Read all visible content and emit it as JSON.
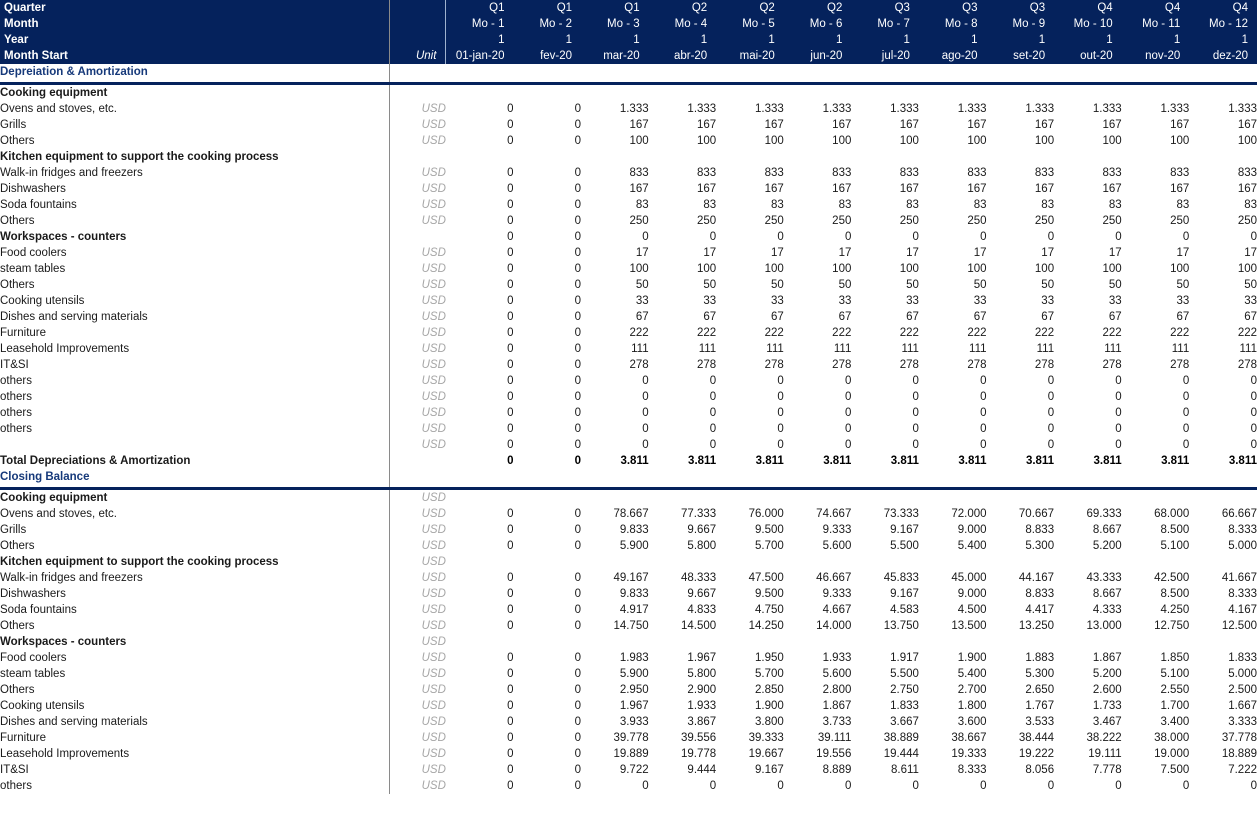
{
  "header": {
    "row_labels": [
      "Quarter",
      "Month",
      "Year",
      "Month Start"
    ],
    "unit_label": "Unit",
    "quarters": [
      "Q1",
      "Q1",
      "Q1",
      "Q2",
      "Q2",
      "Q2",
      "Q3",
      "Q3",
      "Q3",
      "Q4",
      "Q4",
      "Q4"
    ],
    "months": [
      "Mo -  1",
      "Mo -  2",
      "Mo -  3",
      "Mo -  4",
      "Mo -  5",
      "Mo -  6",
      "Mo -  7",
      "Mo -  8",
      "Mo -  9",
      "Mo -  10",
      "Mo -  11",
      "Mo -  12"
    ],
    "years": [
      "1",
      "1",
      "1",
      "1",
      "1",
      "1",
      "1",
      "1",
      "1",
      "1",
      "1",
      "1"
    ],
    "month_start": [
      "01-jan-20",
      "fev-20",
      "mar-20",
      "abr-20",
      "mai-20",
      "jun-20",
      "jul-20",
      "ago-20",
      "set-20",
      "out-20",
      "nov-20",
      "dez-20"
    ]
  },
  "colors": {
    "header_bg": "#05225c",
    "header_text": "#ffffff",
    "section_text": "#16397a",
    "unit_text": "#a6a6a6",
    "body_text": "#1a1a1a"
  },
  "sections": [
    {
      "title": "Depreiation & Amortization",
      "rows": [
        {
          "label": "Cooking equipment",
          "indent": 1,
          "bold": true,
          "unit": "",
          "values": []
        },
        {
          "label": "Ovens and stoves, etc.",
          "indent": 3,
          "bold": false,
          "unit": "USD",
          "values": [
            "0",
            "0",
            "1.333",
            "1.333",
            "1.333",
            "1.333",
            "1.333",
            "1.333",
            "1.333",
            "1.333",
            "1.333",
            "1.333"
          ]
        },
        {
          "label": "Grills",
          "indent": 3,
          "bold": false,
          "unit": "USD",
          "values": [
            "0",
            "0",
            "167",
            "167",
            "167",
            "167",
            "167",
            "167",
            "167",
            "167",
            "167",
            "167"
          ]
        },
        {
          "label": "Others",
          "indent": 2,
          "bold": false,
          "unit": "USD",
          "values": [
            "0",
            "0",
            "100",
            "100",
            "100",
            "100",
            "100",
            "100",
            "100",
            "100",
            "100",
            "100"
          ]
        },
        {
          "label": "Kitchen equipment to support the cooking process",
          "indent": 1,
          "bold": true,
          "unit": "",
          "values": []
        },
        {
          "label": "Walk-in fridges and freezers",
          "indent": 3,
          "bold": false,
          "unit": "USD",
          "values": [
            "0",
            "0",
            "833",
            "833",
            "833",
            "833",
            "833",
            "833",
            "833",
            "833",
            "833",
            "833"
          ]
        },
        {
          "label": "Dishwashers",
          "indent": 3,
          "bold": false,
          "unit": "USD",
          "values": [
            "0",
            "0",
            "167",
            "167",
            "167",
            "167",
            "167",
            "167",
            "167",
            "167",
            "167",
            "167"
          ]
        },
        {
          "label": "Soda fountains",
          "indent": 2,
          "bold": false,
          "unit": "USD",
          "values": [
            "0",
            "0",
            "83",
            "83",
            "83",
            "83",
            "83",
            "83",
            "83",
            "83",
            "83",
            "83"
          ]
        },
        {
          "label": "Others",
          "indent": 2,
          "bold": false,
          "unit": "USD",
          "values": [
            "0",
            "0",
            "250",
            "250",
            "250",
            "250",
            "250",
            "250",
            "250",
            "250",
            "250",
            "250"
          ]
        },
        {
          "label": "Workspaces - counters",
          "indent": 1,
          "bold": true,
          "unit": "",
          "values": [
            "0",
            "0",
            "0",
            "0",
            "0",
            "0",
            "0",
            "0",
            "0",
            "0",
            "0",
            "0"
          ]
        },
        {
          "label": "Food coolers",
          "indent": 3,
          "bold": false,
          "unit": "USD",
          "values": [
            "0",
            "0",
            "17",
            "17",
            "17",
            "17",
            "17",
            "17",
            "17",
            "17",
            "17",
            "17"
          ]
        },
        {
          "label": "steam tables",
          "indent": 3,
          "bold": false,
          "unit": "USD",
          "values": [
            "0",
            "0",
            "100",
            "100",
            "100",
            "100",
            "100",
            "100",
            "100",
            "100",
            "100",
            "100"
          ]
        },
        {
          "label": "Others",
          "indent": 2,
          "bold": false,
          "unit": "USD",
          "values": [
            "0",
            "0",
            "50",
            "50",
            "50",
            "50",
            "50",
            "50",
            "50",
            "50",
            "50",
            "50"
          ]
        },
        {
          "label": "Cooking utensils",
          "indent": 1,
          "bold": false,
          "unit": "USD",
          "values": [
            "0",
            "0",
            "33",
            "33",
            "33",
            "33",
            "33",
            "33",
            "33",
            "33",
            "33",
            "33"
          ]
        },
        {
          "label": "Dishes and serving materials",
          "indent": 1,
          "bold": false,
          "unit": "USD",
          "values": [
            "0",
            "0",
            "67",
            "67",
            "67",
            "67",
            "67",
            "67",
            "67",
            "67",
            "67",
            "67"
          ]
        },
        {
          "label": "Furniture",
          "indent": 1,
          "bold": false,
          "unit": "USD",
          "values": [
            "0",
            "0",
            "222",
            "222",
            "222",
            "222",
            "222",
            "222",
            "222",
            "222",
            "222",
            "222"
          ]
        },
        {
          "label": "Leasehold Improvements",
          "indent": 1,
          "bold": false,
          "unit": "USD",
          "values": [
            "0",
            "0",
            "111",
            "111",
            "111",
            "111",
            "111",
            "111",
            "111",
            "111",
            "111",
            "111"
          ]
        },
        {
          "label": "IT&SI",
          "indent": 1,
          "bold": false,
          "unit": "USD",
          "values": [
            "0",
            "0",
            "278",
            "278",
            "278",
            "278",
            "278",
            "278",
            "278",
            "278",
            "278",
            "278"
          ]
        },
        {
          "label": "others",
          "indent": 1,
          "bold": false,
          "unit": "USD",
          "values": [
            "0",
            "0",
            "0",
            "0",
            "0",
            "0",
            "0",
            "0",
            "0",
            "0",
            "0",
            "0"
          ]
        },
        {
          "label": "others",
          "indent": 1,
          "bold": false,
          "unit": "USD",
          "values": [
            "0",
            "0",
            "0",
            "0",
            "0",
            "0",
            "0",
            "0",
            "0",
            "0",
            "0",
            "0"
          ]
        },
        {
          "label": "others",
          "indent": 1,
          "bold": false,
          "unit": "USD",
          "values": [
            "0",
            "0",
            "0",
            "0",
            "0",
            "0",
            "0",
            "0",
            "0",
            "0",
            "0",
            "0"
          ]
        },
        {
          "label": "others",
          "indent": 1,
          "bold": false,
          "unit": "USD",
          "values": [
            "0",
            "0",
            "0",
            "0",
            "0",
            "0",
            "0",
            "0",
            "0",
            "0",
            "0",
            "0"
          ]
        },
        {
          "label": "",
          "indent": 1,
          "bold": false,
          "unit": "USD",
          "values": [
            "0",
            "0",
            "0",
            "0",
            "0",
            "0",
            "0",
            "0",
            "0",
            "0",
            "0",
            "0"
          ]
        }
      ],
      "total": {
        "label": "Total Depreciations & Amortization",
        "unit": "",
        "values": [
          "0",
          "0",
          "3.811",
          "3.811",
          "3.811",
          "3.811",
          "3.811",
          "3.811",
          "3.811",
          "3.811",
          "3.811",
          "3.811"
        ]
      }
    },
    {
      "title": "Closing Balance",
      "rows": [
        {
          "label": "Cooking equipment",
          "indent": 0,
          "bold": true,
          "unit": "USD",
          "values": []
        },
        {
          "label": "Ovens and stoves, etc.",
          "indent": 4,
          "bold": false,
          "unit": "USD",
          "values": [
            "0",
            "0",
            "78.667",
            "77.333",
            "76.000",
            "74.667",
            "73.333",
            "72.000",
            "70.667",
            "69.333",
            "68.000",
            "66.667"
          ]
        },
        {
          "label": "Grills",
          "indent": 4,
          "bold": false,
          "unit": "USD",
          "values": [
            "0",
            "0",
            "9.833",
            "9.667",
            "9.500",
            "9.333",
            "9.167",
            "9.000",
            "8.833",
            "8.667",
            "8.500",
            "8.333"
          ]
        },
        {
          "label": "Others",
          "indent": 3,
          "bold": false,
          "unit": "USD",
          "values": [
            "0",
            "0",
            "5.900",
            "5.800",
            "5.700",
            "5.600",
            "5.500",
            "5.400",
            "5.300",
            "5.200",
            "5.100",
            "5.000"
          ]
        },
        {
          "label": "Kitchen equipment to support the cooking process",
          "indent": 1,
          "bold": true,
          "unit": "USD",
          "values": []
        },
        {
          "label": "Walk-in fridges and freezers",
          "indent": 4,
          "bold": false,
          "unit": "USD",
          "values": [
            "0",
            "0",
            "49.167",
            "48.333",
            "47.500",
            "46.667",
            "45.833",
            "45.000",
            "44.167",
            "43.333",
            "42.500",
            "41.667"
          ]
        },
        {
          "label": "Dishwashers",
          "indent": 4,
          "bold": false,
          "unit": "USD",
          "values": [
            "0",
            "0",
            "9.833",
            "9.667",
            "9.500",
            "9.333",
            "9.167",
            "9.000",
            "8.833",
            "8.667",
            "8.500",
            "8.333"
          ]
        },
        {
          "label": "Soda fountains",
          "indent": 3,
          "bold": false,
          "unit": "USD",
          "values": [
            "0",
            "0",
            "4.917",
            "4.833",
            "4.750",
            "4.667",
            "4.583",
            "4.500",
            "4.417",
            "4.333",
            "4.250",
            "4.167"
          ]
        },
        {
          "label": "Others",
          "indent": 3,
          "bold": false,
          "unit": "USD",
          "values": [
            "0",
            "0",
            "14.750",
            "14.500",
            "14.250",
            "14.000",
            "13.750",
            "13.500",
            "13.250",
            "13.000",
            "12.750",
            "12.500"
          ]
        },
        {
          "label": "Workspaces - counters",
          "indent": 1,
          "bold": true,
          "unit": "USD",
          "values": []
        },
        {
          "label": "Food coolers",
          "indent": 4,
          "bold": false,
          "unit": "USD",
          "values": [
            "0",
            "0",
            "1.983",
            "1.967",
            "1.950",
            "1.933",
            "1.917",
            "1.900",
            "1.883",
            "1.867",
            "1.850",
            "1.833"
          ]
        },
        {
          "label": "steam tables",
          "indent": 4,
          "bold": false,
          "unit": "USD",
          "values": [
            "0",
            "0",
            "5.900",
            "5.800",
            "5.700",
            "5.600",
            "5.500",
            "5.400",
            "5.300",
            "5.200",
            "5.100",
            "5.000"
          ]
        },
        {
          "label": "Others",
          "indent": 3,
          "bold": false,
          "unit": "USD",
          "values": [
            "0",
            "0",
            "2.950",
            "2.900",
            "2.850",
            "2.800",
            "2.750",
            "2.700",
            "2.650",
            "2.600",
            "2.550",
            "2.500"
          ]
        },
        {
          "label": "Cooking utensils",
          "indent": 2,
          "bold": false,
          "unit": "USD",
          "values": [
            "0",
            "0",
            "1.967",
            "1.933",
            "1.900",
            "1.867",
            "1.833",
            "1.800",
            "1.767",
            "1.733",
            "1.700",
            "1.667"
          ]
        },
        {
          "label": "Dishes and serving materials",
          "indent": 2,
          "bold": false,
          "unit": "USD",
          "values": [
            "0",
            "0",
            "3.933",
            "3.867",
            "3.800",
            "3.733",
            "3.667",
            "3.600",
            "3.533",
            "3.467",
            "3.400",
            "3.333"
          ]
        },
        {
          "label": "Furniture",
          "indent": 2,
          "bold": false,
          "unit": "USD",
          "values": [
            "0",
            "0",
            "39.778",
            "39.556",
            "39.333",
            "39.111",
            "38.889",
            "38.667",
            "38.444",
            "38.222",
            "38.000",
            "37.778"
          ]
        },
        {
          "label": "Leasehold Improvements",
          "indent": 2,
          "bold": false,
          "unit": "USD",
          "values": [
            "0",
            "0",
            "19.889",
            "19.778",
            "19.667",
            "19.556",
            "19.444",
            "19.333",
            "19.222",
            "19.111",
            "19.000",
            "18.889"
          ]
        },
        {
          "label": "IT&SI",
          "indent": 2,
          "bold": false,
          "unit": "USD",
          "values": [
            "0",
            "0",
            "9.722",
            "9.444",
            "9.167",
            "8.889",
            "8.611",
            "8.333",
            "8.056",
            "7.778",
            "7.500",
            "7.222"
          ]
        },
        {
          "label": "others",
          "indent": 2,
          "bold": false,
          "unit": "USD",
          "values": [
            "0",
            "0",
            "0",
            "0",
            "0",
            "0",
            "0",
            "0",
            "0",
            "0",
            "0",
            "0"
          ]
        }
      ],
      "total": null
    }
  ]
}
